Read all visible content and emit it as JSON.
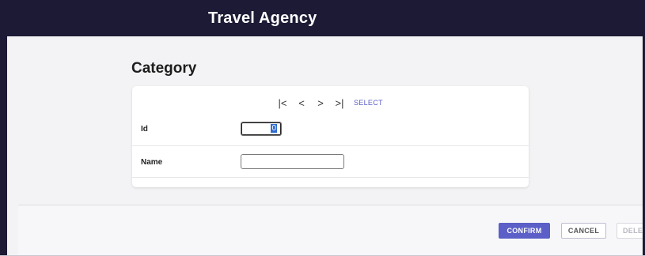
{
  "header": {
    "title": "Travel Agency"
  },
  "page": {
    "title": "Category"
  },
  "nav": {
    "first": "|<",
    "prev": "<",
    "next": ">",
    "last": ">|",
    "select_label": "SELECT"
  },
  "form": {
    "id": {
      "label": "Id",
      "value": "0"
    },
    "name": {
      "label": "Name",
      "value": ""
    }
  },
  "actions": {
    "confirm": "CONFIRM",
    "cancel": "CANCEL",
    "delete": "DELETE"
  },
  "colors": {
    "header_bg": "#1c1a35",
    "accent": "#5b5fc7"
  }
}
